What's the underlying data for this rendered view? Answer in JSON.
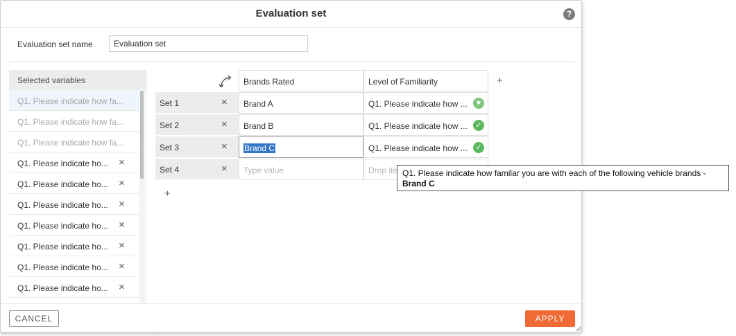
{
  "dialog": {
    "title": "Evaluation set",
    "help_icon": "?"
  },
  "name_field": {
    "label": "Evaluation set name",
    "value": "Evaluation set"
  },
  "variables": {
    "header": "Selected variables",
    "items": [
      {
        "label": "Q1. Please indicate how fa...",
        "state": "active-dim"
      },
      {
        "label": "Q1. Please indicate how fa...",
        "state": "dim"
      },
      {
        "label": "Q1. Please indicate how fa...",
        "state": "dim"
      },
      {
        "label": "Q1. Please indicate ho...",
        "state": "removable"
      },
      {
        "label": "Q1. Please indicate ho...",
        "state": "removable"
      },
      {
        "label": "Q1. Please indicate ho...",
        "state": "removable"
      },
      {
        "label": "Q1. Please indicate ho...",
        "state": "removable"
      },
      {
        "label": "Q1. Please indicate ho...",
        "state": "removable"
      },
      {
        "label": "Q1. Please indicate ho...",
        "state": "removable"
      },
      {
        "label": "Q1. Please indicate ho...",
        "state": "removable"
      }
    ],
    "remove_icon": "×"
  },
  "grid": {
    "columns": [
      "Brands Rated",
      "Level of Familiarity"
    ],
    "add_column": "+",
    "add_row": "+",
    "remove_icon": "×",
    "rows": [
      {
        "label": "Set 1",
        "brand": "Brand A",
        "familiarity": "Q1. Please indicate how ...",
        "status": "star-check"
      },
      {
        "label": "Set 2",
        "brand": "Brand B",
        "familiarity": "Q1. Please indicate how ...",
        "status": "check"
      },
      {
        "label": "Set 3",
        "brand": "Brand C",
        "familiarity": "Q1. Please indicate how ...",
        "status": "check"
      },
      {
        "label": "Set 4",
        "brand_placeholder": "Type value",
        "familiarity_placeholder": "Drop ite"
      }
    ]
  },
  "tooltip": {
    "line1": "Q1. Please indicate how familar you are with each of the following vehicle brands -",
    "line2": "Brand C"
  },
  "footer": {
    "cancel_label": "CANCEL",
    "apply_label": "APPLY"
  },
  "colors": {
    "accent": "#f06a35",
    "check": "#5cb85c",
    "selection": "#3275c9"
  }
}
